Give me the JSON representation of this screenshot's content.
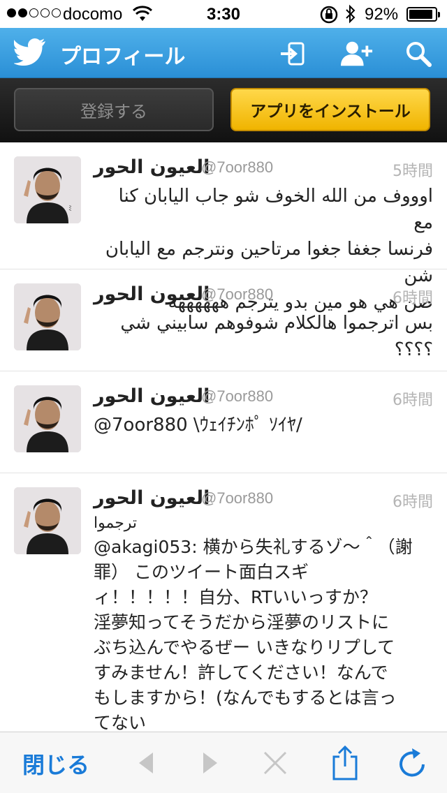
{
  "status_bar": {
    "carrier": "docomo",
    "time": "3:30",
    "battery_percent": "92%",
    "signal_bars_filled": 2,
    "signal_bars_total": 5,
    "battery_level": 0.92
  },
  "nav": {
    "title": "プロフィール",
    "icons": [
      "twitter-bird-icon",
      "sign-in-icon",
      "add-user-icon",
      "search-icon"
    ]
  },
  "action_bar": {
    "register_label": "登録する",
    "install_label": "アプリをインストール"
  },
  "tweets": [
    {
      "name": "العيون الحور",
      "handle": "@7oor880",
      "time": "5時間",
      "rtl": true,
      "lines": [
        "اوووف من الله الخوف شو جاب اليابان كنا مع",
        "فرنسا جغفا جغوا مرتاحين ونترجم مع اليابان شن",
        "صن هي هو مين بدو يترجم ههههههه"
      ]
    },
    {
      "name": "العيون الحور",
      "handle": "@7oor880",
      "time": "6時間",
      "rtl": true,
      "lines": [
        "بس اترجموا هالكلام شوفوهم سابيني شي ؟؟؟؟"
      ]
    },
    {
      "name": "العيون الحور",
      "handle": "@7oor880",
      "time": "6時間",
      "rtl": false,
      "lines": [
        "@7oor880 \\ｳｪｲﾁﾝﾎﾟ ｿｲﾔ/"
      ]
    },
    {
      "name": "العيون الحور",
      "handle": "@7oor880",
      "time": "6時間",
      "rtl": false,
      "lines": [
        "ترجموا",
        "@akagi053: 横から失礼するゾ～＾（謝",
        "罪） このツイート面白スギ",
        "ィ！！！！！自分、RTいいっすか？",
        "淫夢知ってそうだから淫夢のリストに",
        "ぶち込んでやるぜー いきなりリプして",
        "すみません！許してください！なんで",
        "もしますから！(なんでもするとは言っ",
        "てない"
      ]
    }
  ],
  "bottom_bar": {
    "close_label": "閉じる",
    "icons": [
      "back-arrow-icon",
      "forward-arrow-icon",
      "stop-icon",
      "share-icon",
      "reload-icon"
    ]
  },
  "colors": {
    "nav_blue": "#2a8fd6",
    "install_yellow": "#f7c21b",
    "link_blue": "#1a7bd8"
  }
}
